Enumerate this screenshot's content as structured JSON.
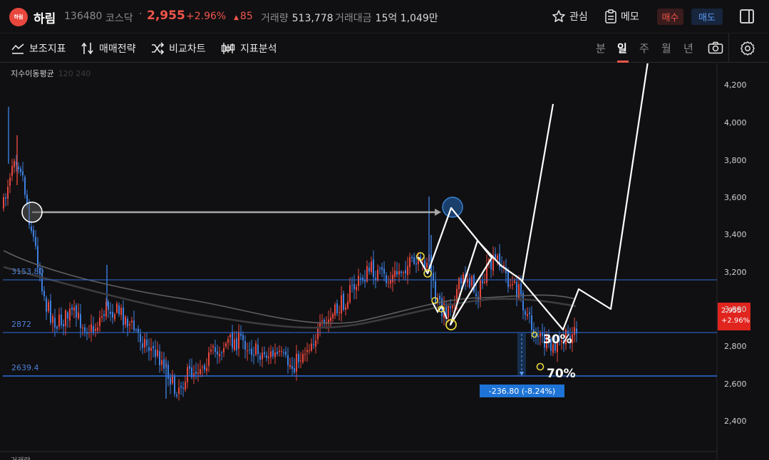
{
  "header": {
    "logo_text": "하림",
    "name": "하림",
    "code": "136480",
    "market": "코스닥",
    "separator": "·",
    "price": "2,955",
    "change_pct": "+2.96%",
    "change_arrow": "▲",
    "change_abs": "85",
    "volume_label": "거래량",
    "volume_value": "513,778",
    "amount_label": "거래대금",
    "amount_value": "15억 1,049만",
    "watch_label": "관심",
    "memo_label": "메모",
    "buy_label": "매수",
    "sell_label": "매도"
  },
  "toolbar": {
    "indicators": "보조지표",
    "strategy": "매매전략",
    "compare": "비교차트",
    "analysis": "지표분석",
    "periods": [
      "분",
      "일",
      "주",
      "월",
      "년"
    ],
    "active_period": "일"
  },
  "chart": {
    "indicator_label": "지수이동평균",
    "indicator_params": "120 240",
    "levels": [
      {
        "label": "3153.80",
        "value": 3153.8
      },
      {
        "label": "2872",
        "value": 2872
      },
      {
        "label": "2639.4",
        "value": 2639.4
      }
    ],
    "current_price": "2,955",
    "current_pct": "+2.96%",
    "measure_label": "-236.80 (-8.24%)",
    "annotation_30": "30%",
    "annotation_70": "70%",
    "y_ticks": [
      "4,200",
      "4,000",
      "3,800",
      "3,600",
      "3,400",
      "3,200",
      "3,000",
      "2,800",
      "2,600",
      "2,400"
    ],
    "bottom_label": "거래량",
    "colors": {
      "up": "#e8473d",
      "down": "#3d7fe0",
      "level": "#2f6fdc",
      "ma1": "#6a6a6a",
      "ma2": "#3a3a3a"
    }
  }
}
